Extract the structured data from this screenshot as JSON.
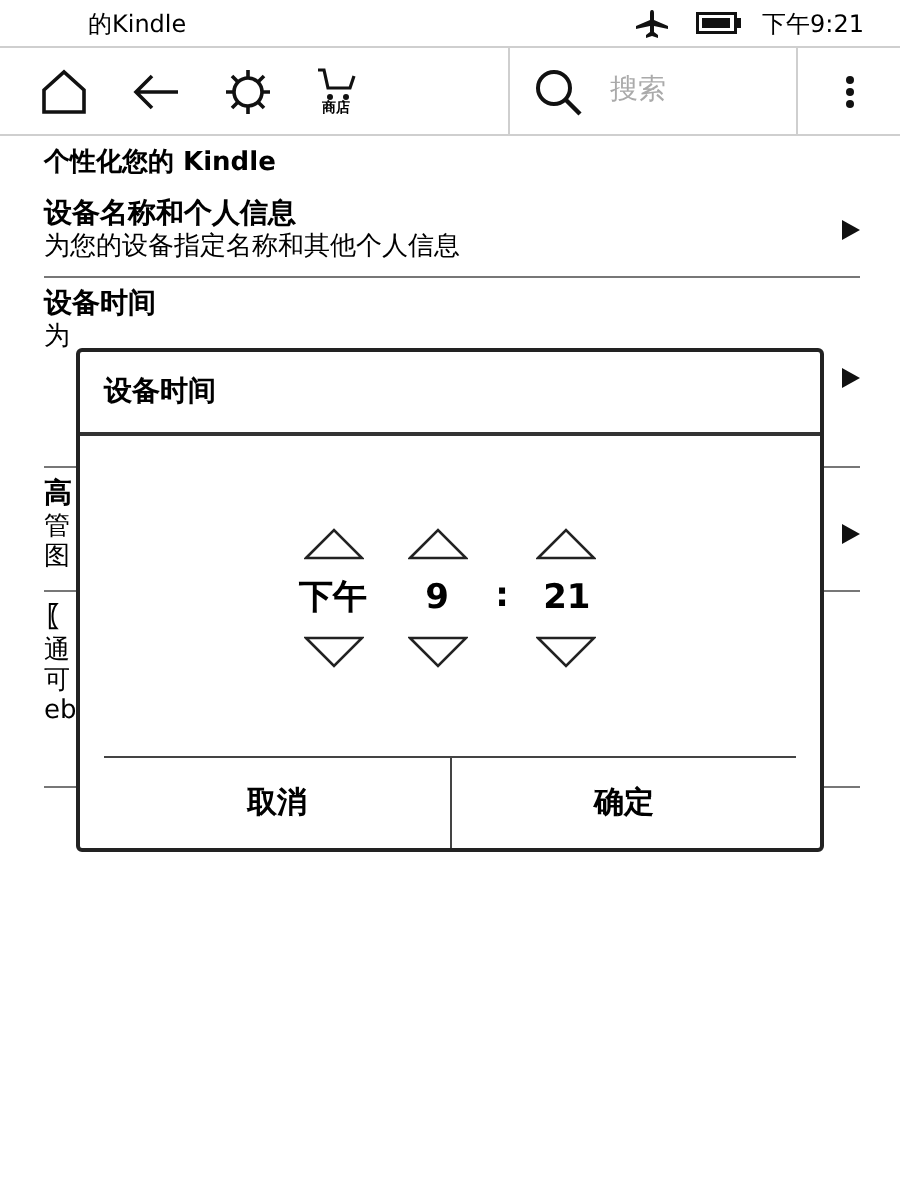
{
  "status_bar": {
    "title": "的Kindle",
    "airplane_mode": true,
    "time": "下午9:21"
  },
  "toolbar": {
    "store_label": "商店",
    "search": {
      "placeholder": "搜索"
    }
  },
  "section_title": "个性化您的 Kindle",
  "settings": [
    {
      "title": "设备名称和个人信息",
      "lines": [
        "为您的设备指定名称和其他个人信息"
      ]
    },
    {
      "title": "设备时间",
      "lines": [
        "为"
      ]
    },
    {
      "title": "高",
      "lines": [
        "管",
        "图"
      ]
    },
    {
      "title": "〖",
      "lines": [
        "通",
        "可",
        "eb"
      ]
    }
  ],
  "dialog": {
    "title": "设备时间",
    "fields": [
      {
        "value": "下午"
      },
      {
        "value": "9"
      },
      {
        "value": "21"
      }
    ],
    "separator": ":",
    "buttons": [
      "取消",
      "确定"
    ]
  }
}
